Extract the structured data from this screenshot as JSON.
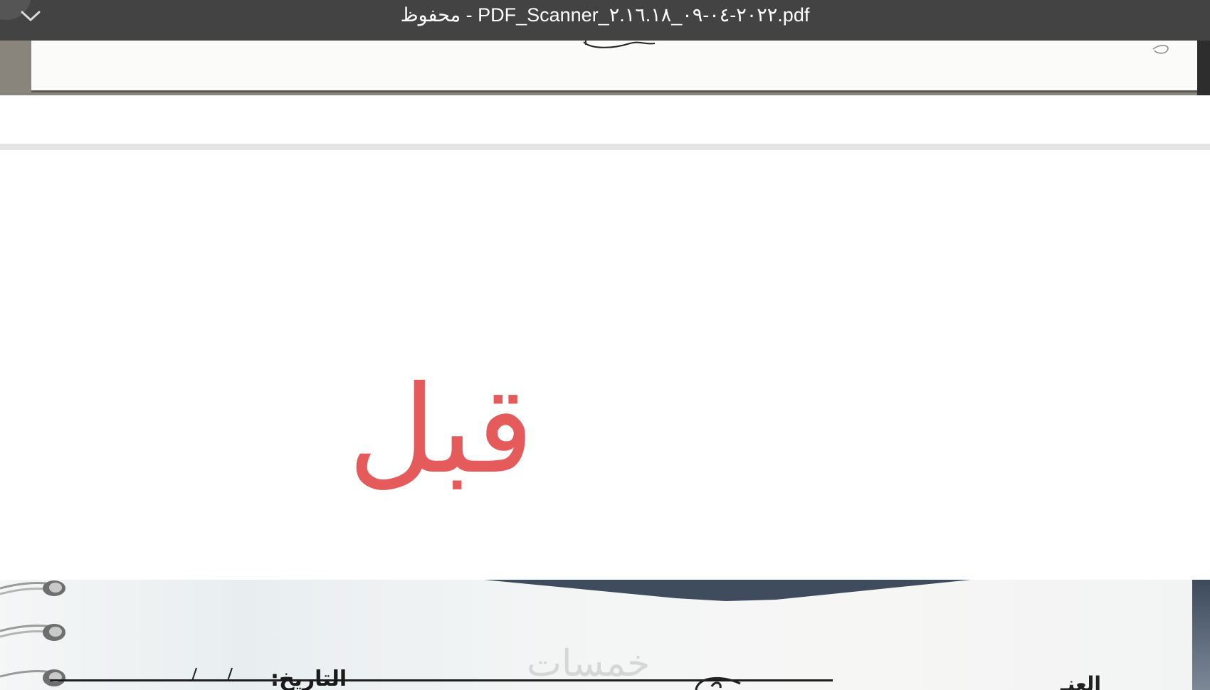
{
  "titlebar": {
    "title": "محفوظ - PDF_Scanner_٢٠٢٢-٠٤-٠٩_٢.١٦.١٨.pdf",
    "collapse_icon": "chevron-down-icon"
  },
  "page2": {
    "before_label": "قبل",
    "before_label_color": "#e55a5a",
    "scan": {
      "date_label": "التاريخ:",
      "watermark": "خمسات",
      "right_partial_text": "العنـ"
    }
  },
  "colors": {
    "titlebar_bg": "#434343",
    "page_gap": "#e5e5e5",
    "page_bg": "#ffffff"
  }
}
